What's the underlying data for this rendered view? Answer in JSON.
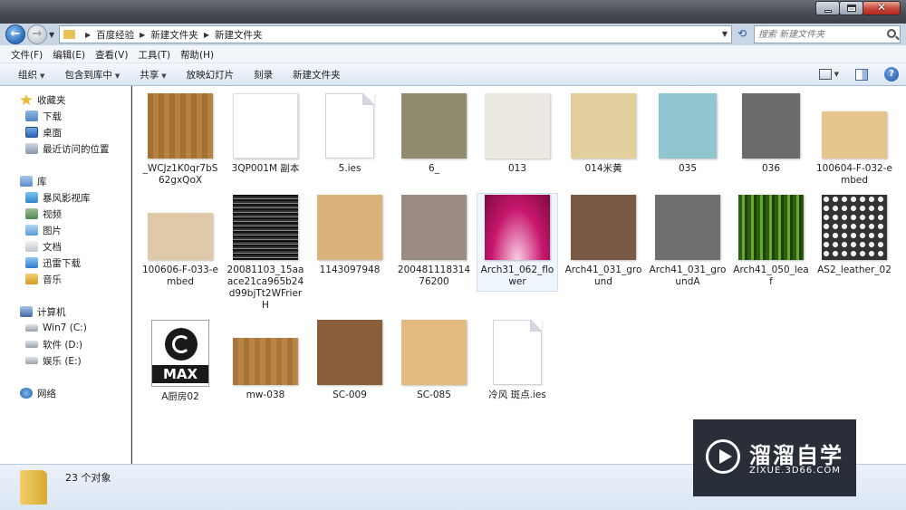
{
  "address": {
    "crumbs": [
      "百度经验",
      "新建文件夹",
      "新建文件夹"
    ],
    "search_placeholder": "搜索 新建文件夹"
  },
  "menu": [
    "文件(F)",
    "编辑(E)",
    "查看(V)",
    "工具(T)",
    "帮助(H)"
  ],
  "toolbar": {
    "organize": "组织",
    "include_in_library": "包含到库中",
    "share": "共享",
    "slideshow": "放映幻灯片",
    "burn": "刻录",
    "new_folder": "新建文件夹"
  },
  "sidebar": {
    "favorites": "收藏夹",
    "favorite_items": [
      "下载",
      "桌面",
      "最近访问的位置"
    ],
    "libraries": "库",
    "library_items": [
      "暴风影视库",
      "视频",
      "图片",
      "文档",
      "迅雷下载",
      "音乐"
    ],
    "computer": "计算机",
    "drives": [
      "Win7 (C:)",
      "软件 (D:)",
      "娱乐 (E:)"
    ],
    "network": "网络"
  },
  "files": [
    {
      "name": "_WCJz1K0qr7bS62gxQoX",
      "kind": "image",
      "color": "#b07a35"
    },
    {
      "name": "3QP001M 副本",
      "kind": "image",
      "color": "#ffffff"
    },
    {
      "name": "5.ies",
      "kind": "doc"
    },
    {
      "name": "6_",
      "kind": "image",
      "color": "#8f8c6e"
    },
    {
      "name": "013",
      "kind": "image",
      "color": "#ece9e2"
    },
    {
      "name": "014米黄",
      "kind": "image",
      "color": "#e3cf9e"
    },
    {
      "name": "035",
      "kind": "image",
      "color": "#8fc6cf"
    },
    {
      "name": "036",
      "kind": "image",
      "color": "#6b6b6b"
    },
    {
      "name": "100604-F-032-embed",
      "kind": "image",
      "color": "#e6c58c"
    },
    {
      "name": "100606-F-033-embed",
      "kind": "image",
      "color": "#e0c9a8"
    },
    {
      "name": "20081103_15aaace21ca965b24d99bjTt2WFrierH",
      "kind": "image",
      "color": "#3a3a3a"
    },
    {
      "name": "1143097948",
      "kind": "image",
      "color": "#d9b27c"
    },
    {
      "name": "20048111831476200",
      "kind": "image",
      "color": "#9a8c83"
    },
    {
      "name": "Arch31_062_flower",
      "kind": "image",
      "color": "#c8176e",
      "selected": true
    },
    {
      "name": "Arch41_031_ground",
      "kind": "image",
      "color": "#7a5a44"
    },
    {
      "name": "Arch41_031_groundA",
      "kind": "image",
      "color": "#6f6f6f"
    },
    {
      "name": "Arch41_050_leaf",
      "kind": "image",
      "color": "#3b7a1c"
    },
    {
      "name": "AS2_leather_02",
      "kind": "image",
      "color": "#d2d2d2"
    },
    {
      "name": "A厨房02",
      "kind": "max"
    },
    {
      "name": "mw-038",
      "kind": "image",
      "color": "#b57f39"
    },
    {
      "name": "SC-009",
      "kind": "image",
      "color": "#8b5e3b"
    },
    {
      "name": "SC-085",
      "kind": "image",
      "color": "#e3bb82"
    },
    {
      "name": "冷风 斑点.ies",
      "kind": "doc"
    }
  ],
  "max_label": "MAX",
  "status": {
    "count": "23 个对象"
  },
  "watermark": {
    "title": "溜溜自学",
    "url": "ZIXUE.3D66.COM"
  }
}
